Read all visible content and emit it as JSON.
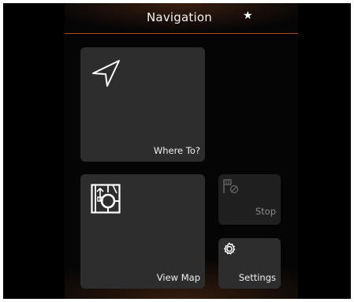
{
  "header": {
    "title": "Navigation",
    "favorite_icon": "star-icon",
    "favorite_glyph": "★"
  },
  "tiles": {
    "where_to": {
      "label": "Where To?",
      "icon": "arrow-cursor-icon"
    },
    "view_map": {
      "label": "View Map",
      "icon": "map-roundabout-icon"
    },
    "stop": {
      "label": "Stop",
      "icon": "stop-flag-icon",
      "enabled": false
    },
    "settings": {
      "label": "Settings",
      "icon": "gear-icon"
    }
  },
  "colors": {
    "accent": "#b4461e",
    "tile": "#2d2d2d",
    "tile_disabled": "#1f1f1f",
    "text": "#f0f0f0",
    "text_disabled": "#8c8c8c"
  }
}
